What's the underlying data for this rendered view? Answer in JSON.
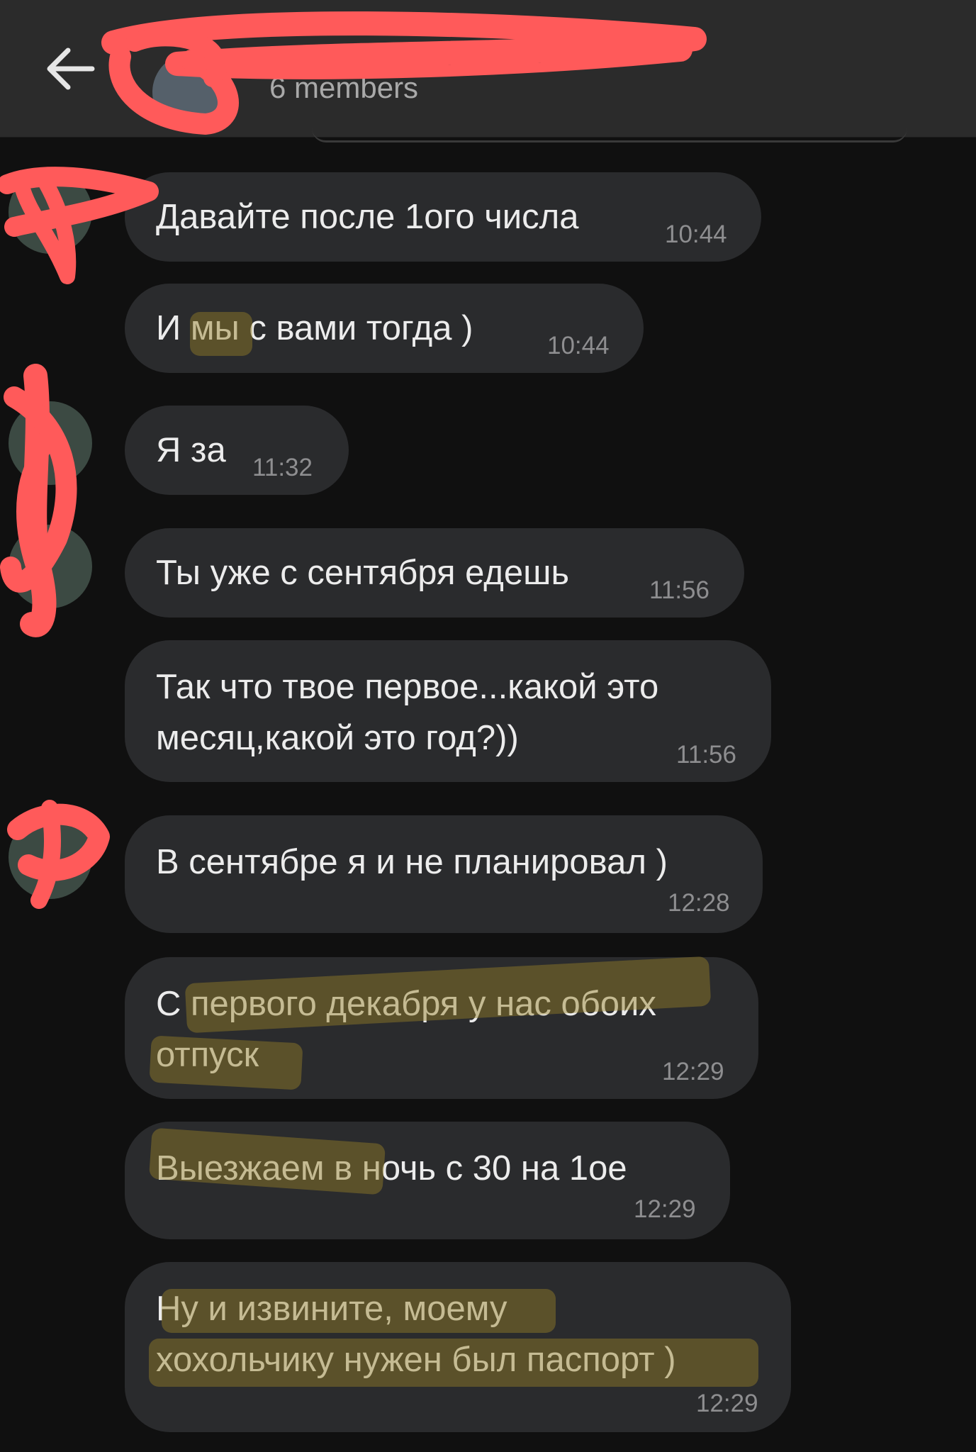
{
  "header": {
    "title": "",
    "members": "6 members",
    "back_icon": "arrow-left-icon"
  },
  "messages": [
    {
      "text": "Давайте после 1ого числа",
      "time": "10:44"
    },
    {
      "text": "И мы с вами тогда )",
      "time": "10:44"
    },
    {
      "text": "Я за",
      "time": "11:32"
    },
    {
      "text": "Ты уже с сентября едешь",
      "time": "11:56"
    },
    {
      "text": "Так что твое первое...какой это\nмесяц,какой это год?))",
      "time": "11:56"
    },
    {
      "text": "В сентябре я и не планировал )",
      "time": "12:28"
    },
    {
      "text": "С первого декабря у нас обоих\nотпуск",
      "time": "12:29"
    },
    {
      "text": "Выезжаем в ночь с 30 на 1ое",
      "time": "12:29"
    },
    {
      "text": "Ну и извините, моему\nхохольчику нужен был паспорт )",
      "time": "12:29"
    }
  ],
  "colors": {
    "background": "#101010",
    "header": "#2b2b2b",
    "bubble": "#2a2b2d",
    "redaction": "#ff5a5a",
    "highlight": "#8a7424"
  }
}
